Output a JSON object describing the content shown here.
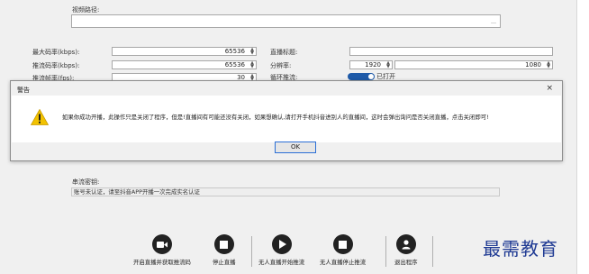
{
  "form": {
    "video_path_label": "视频路径:",
    "video_path_value": "",
    "max_bitrate_label": "最大码率(kbps):",
    "max_bitrate_value": "65536",
    "push_bitrate_label": "推流码率(kbps):",
    "push_bitrate_value": "65536",
    "push_fps_label": "推流帧率(fps):",
    "push_fps_value": "30",
    "live_title_label": "直播标题:",
    "live_title_value": "",
    "resolution_label": "分辨率:",
    "resolution_width": "1920",
    "resolution_height": "1080",
    "loop_push_label": "循环推流:",
    "loop_push_toggle_text": "已打开",
    "loop_push_on": true,
    "push_key_label": "串流密钥:",
    "push_key_value": "账号未认证，请至抖音APP开播一次完成实名认证"
  },
  "dialog": {
    "title": "警告",
    "close_glyph": "×",
    "message": "如果你成功开播，此操作只是关闭了程序，但是!直播间有可能还没有关闭，如果想确认,请打开手机抖音进别人的直播间，这时会弹出询问是否关闭直播，点击关闭即可!",
    "ok_label": "OK",
    "icon": "warning-icon",
    "icon_color": "#f2c200"
  },
  "toolbar": {
    "start_label": "开启直播并获取推流码",
    "stop_label": "停止直播",
    "unattended_start_label": "无人直播开始推流",
    "unattended_stop_label": "无人直播停止推流",
    "exit_label": "退出程序"
  },
  "watermark": "最需教育"
}
